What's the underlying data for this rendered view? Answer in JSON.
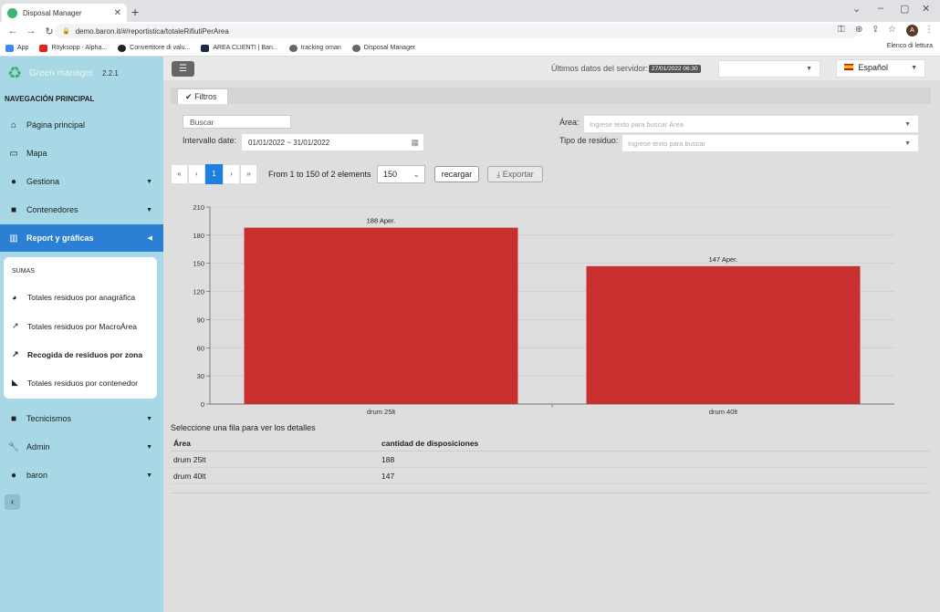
{
  "browser": {
    "tab_title": "Disposal Manager",
    "url": "demo.baron.it/#/reportistica/totaleRifiutiPerArea",
    "avatar_letter": "A",
    "bookmarks": [
      "App",
      "Röyksopp - Alpha...",
      "Convertitore di valu...",
      "AREA CLIENTI | Ban...",
      "tracking oman",
      "Disposal Manager"
    ],
    "reading_list": "Elenco di lettura"
  },
  "app": {
    "brand": "Green manager",
    "version": "2.2.1",
    "nav_header": "NAVEGACIÓN PRINCIPAL"
  },
  "sidebar": {
    "items": [
      {
        "label": "Página principal",
        "icon": "home-icon"
      },
      {
        "label": "Mapa",
        "icon": "map-icon"
      },
      {
        "label": "Gestiona",
        "icon": "users-icon"
      },
      {
        "label": "Contenedores",
        "icon": "archive-icon"
      },
      {
        "label": "Report y gráficas",
        "icon": "chart-icon"
      },
      {
        "label": "Tecnicismos",
        "icon": "archive-icon"
      },
      {
        "label": "Admin",
        "icon": "wrench-icon"
      },
      {
        "label": "baron",
        "icon": "user-icon"
      }
    ],
    "submenu_header": "SUMAS",
    "submenu": [
      {
        "label": "Totales residuos por anagráfica"
      },
      {
        "label": "Totales residuos por MacroÁrea"
      },
      {
        "label": "Recogida de residuos por zona"
      },
      {
        "label": "Totales residuos por contenedor"
      }
    ]
  },
  "header": {
    "server_label": "Últimos datos del servidor:",
    "server_date": "27/01/2022 06:30",
    "language": "Español"
  },
  "filters": {
    "tab_label": "Filtros",
    "search_placeholder": "Buscar",
    "interval_label": "Intervallo date:",
    "interval_value": "01/01/2022 ~ 31/01/2022",
    "area_label": "Área:",
    "area_placeholder": "Ingrese texto para buscar Área",
    "tipo_label": "Tipo de residuo:",
    "tipo_placeholder": "Ingrese texto para buscar"
  },
  "pager": {
    "first": "«",
    "prev": "‹",
    "current": "1",
    "next": "›",
    "last": "»",
    "info": "From 1 to 150 of 2 elements",
    "page_size": "150",
    "reload": "recargar",
    "export": "Exportar"
  },
  "chart_data": {
    "type": "bar",
    "categories": [
      "drum 25lt",
      "drum 40lt"
    ],
    "values": [
      188,
      147
    ],
    "data_labels": [
      "188 Aper.",
      "147 Aper."
    ],
    "yticks": [
      0,
      30,
      60,
      90,
      120,
      150,
      180,
      210
    ],
    "ylim": [
      0,
      210
    ],
    "bar_color": "#c8302f",
    "grid": true
  },
  "table": {
    "hint": "Seleccione una fila para ver los detalles",
    "headers": [
      "Área",
      "cantidad de disposiciones"
    ],
    "rows": [
      [
        "drum 25lt",
        "188"
      ],
      [
        "drum 40lt",
        "147"
      ]
    ]
  }
}
